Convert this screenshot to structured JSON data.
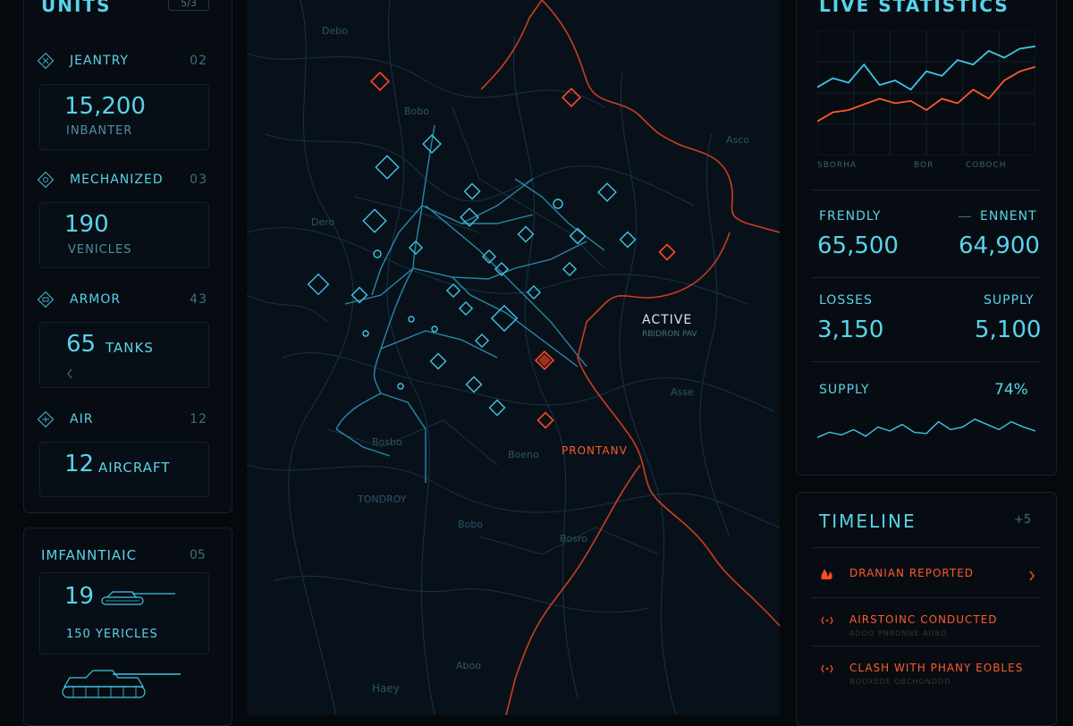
{
  "units_panel": {
    "title": "UNITS",
    "count": "5/3",
    "categories": [
      {
        "label": "JEANTRY",
        "num": "02",
        "value": "15,200",
        "sub": "INBANTER",
        "icon": "infantry-icon"
      },
      {
        "label": "MECHANIZED",
        "num": "03",
        "value": "190",
        "sub": "VENICLES",
        "icon": "mechanized-icon"
      },
      {
        "label": "ARMOR",
        "num": "43",
        "value": "65",
        "value_unit": "TANKS",
        "icon": "armor-icon"
      },
      {
        "label": "AIR",
        "num": "12",
        "value": "12",
        "value_unit": "AIRCRAFT",
        "icon": "air-icon"
      }
    ]
  },
  "detail_panel": {
    "title": "IMFANNTIAIC",
    "num": "05",
    "value": "19",
    "sub": "150 YERICLES",
    "icon": "tank-icon"
  },
  "map": {
    "labels": {
      "active": "ACTIVE",
      "active_sub": "RBIDRON PAV",
      "front": "PRONTANV",
      "place_1": "Debo",
      "place_2": "Bobo",
      "place_3": "Dero",
      "place_4": "Bosbo",
      "place_5": "TONDROY",
      "place_6": "Boeno",
      "place_7": "Bobo",
      "place_8": "Bosro",
      "place_9": "Haey",
      "place_10": "Aboo",
      "place_11": "Asse",
      "place_12": "Asco"
    },
    "colors": {
      "friendly": "#3fc6e6",
      "enemy": "#ff4a22",
      "road": "#1f5e78"
    }
  },
  "live_stats": {
    "title": "LIVE STATISTICS",
    "legend": [
      "SBORHA",
      "BOR",
      "COBOCH"
    ],
    "chart_data": {
      "type": "line",
      "x": [
        0,
        1,
        2,
        3,
        4,
        5,
        6,
        7,
        8,
        9,
        10,
        11,
        12,
        13,
        14
      ],
      "series": [
        {
          "values": [
            60,
            68,
            64,
            80,
            62,
            66,
            58,
            74,
            70,
            84,
            80,
            92,
            86,
            94,
            96
          ],
          "color": "#3fc6e6"
        },
        {
          "values": [
            30,
            38,
            40,
            45,
            50,
            46,
            48,
            40,
            50,
            46,
            58,
            50,
            66,
            74,
            78
          ],
          "color": "#ff5a2e"
        }
      ],
      "ylim": [
        0,
        110
      ],
      "grid": true
    },
    "friendly_label": "FRENDLY",
    "enemy_label": "ENNENT",
    "friendly_value": "65,500",
    "enemy_value": "64,900",
    "losses_label": "LOSSES",
    "supply_label": "SUPPLY",
    "losses_value": "3,150",
    "supply_value": "5,100",
    "supply_pct_label": "SUPPLY",
    "supply_pct": "74%",
    "supply_line": {
      "type": "line",
      "values": [
        30,
        34,
        32,
        36,
        31,
        38,
        35,
        40,
        34,
        33,
        42,
        36,
        38,
        44,
        40,
        36,
        42,
        38,
        35
      ]
    }
  },
  "timeline": {
    "title": "TIMELINE",
    "badge": "+5",
    "items": [
      {
        "text": "DRANIAN REPORTED",
        "sub": "",
        "icon": "flame-icon"
      },
      {
        "text": "AIRSTOINC CONDUCTED",
        "sub": "ADOO  PNRONNE ADBO",
        "icon": "diamond-icon"
      },
      {
        "text": "CLASH WITH PHANY EOBLES",
        "sub": "NOOXEDE  OBCHONDOD",
        "icon": "diamond-icon"
      }
    ]
  }
}
